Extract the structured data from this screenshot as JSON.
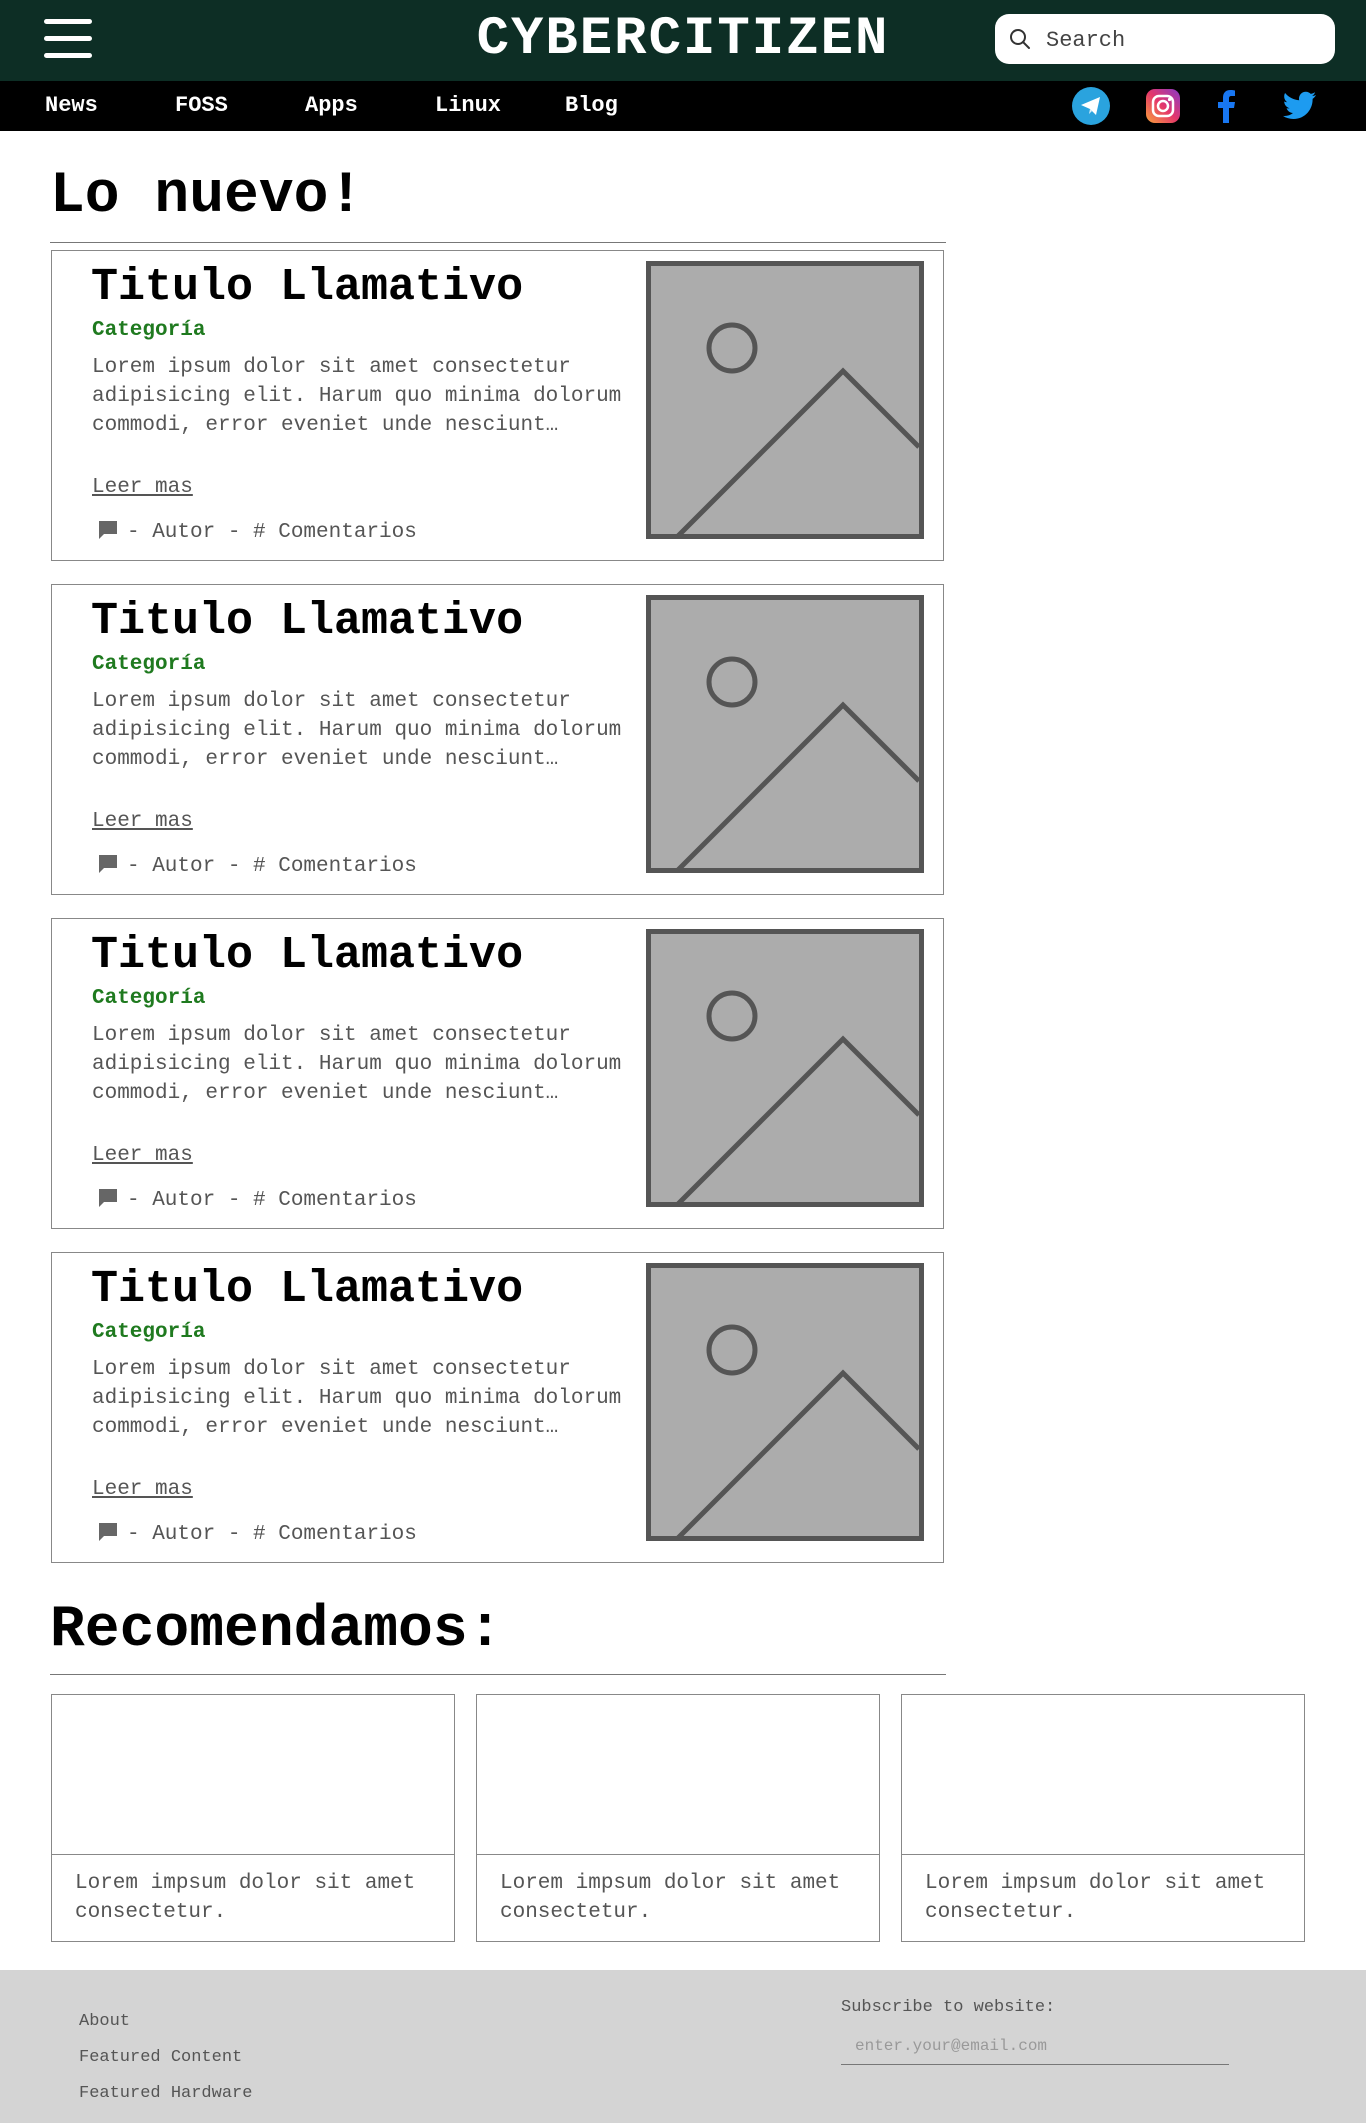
{
  "header": {
    "brand": "CYBERCITIZEN",
    "search_placeholder": "Search",
    "colors": {
      "background": "#0d2e25",
      "nav_background": "#000000"
    }
  },
  "nav": {
    "items": [
      "News",
      "FOSS",
      "Apps",
      "Linux",
      "Blog"
    ],
    "social": [
      "telegram-icon",
      "instagram-icon",
      "facebook-icon",
      "twitter-icon"
    ]
  },
  "main": {
    "heading": "Lo nuevo!",
    "articles": [
      {
        "title": "Titulo Llamativo",
        "category": "Categoría",
        "excerpt": "Lorem ipsum dolor sit amet consectetur adipisicing elit. Harum quo minima dolorum commodi, error eveniet unde nesciunt…",
        "read_more": "Leer mas",
        "meta": "- Autor - # Comentarios",
        "image": "image-placeholder-icon"
      },
      {
        "title": "Titulo Llamativo",
        "category": "Categoría",
        "excerpt": "Lorem ipsum dolor sit amet consectetur adipisicing elit. Harum quo minima dolorum commodi, error eveniet unde nesciunt…",
        "read_more": "Leer mas",
        "meta": "- Autor - # Comentarios",
        "image": "image-placeholder-icon"
      },
      {
        "title": "Titulo Llamativo",
        "category": "Categoría",
        "excerpt": "Lorem ipsum dolor sit amet consectetur adipisicing elit. Harum quo minima dolorum commodi, error eveniet unde nesciunt…",
        "read_more": "Leer mas",
        "meta": "- Autor - # Comentarios",
        "image": "image-placeholder-icon"
      },
      {
        "title": "Titulo Llamativo",
        "category": "Categoría",
        "excerpt": "Lorem ipsum dolor sit amet consectetur adipisicing elit. Harum quo minima dolorum commodi, error eveniet unde nesciunt…",
        "read_more": "Leer mas",
        "meta": "- Autor - # Comentarios",
        "image": "image-placeholder-icon"
      }
    ],
    "category_color": "#1f7a1f"
  },
  "recommend": {
    "heading": "Recomendamos:",
    "items": [
      {
        "text": "Lorem impsum dolor sit amet consectetur."
      },
      {
        "text": "Lorem impsum dolor sit amet consectetur."
      },
      {
        "text": "Lorem impsum dolor sit amet consectetur."
      }
    ]
  },
  "footer": {
    "links": [
      "About",
      "Featured Content",
      "Featured Hardware"
    ],
    "subscribe_label": "Subscribe to website:",
    "email_placeholder": "enter.your@email.com",
    "background": "#d4d4d4"
  }
}
